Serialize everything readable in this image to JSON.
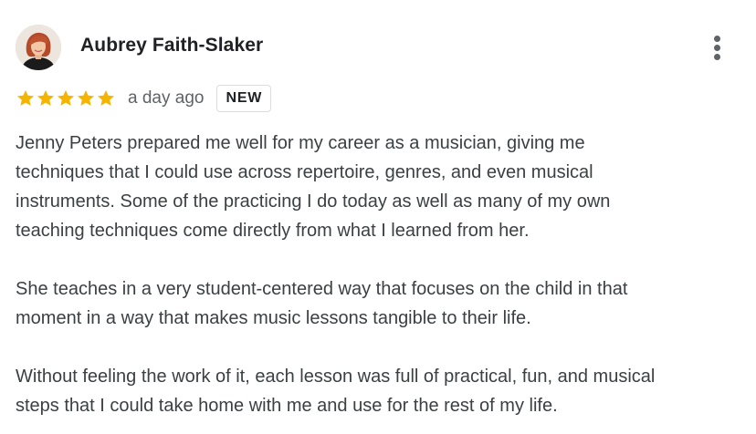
{
  "review": {
    "author_name": "Aubrey Faith-Slaker",
    "rating": 5,
    "rating_max": 5,
    "time_ago": "a day ago",
    "badge": "NEW",
    "star_color": "#f4b400",
    "paragraphs": [
      "Jenny Peters prepared me well for my career as a musician, giving me\ntechniques that I could use across repertoire, genres, and even musical\ninstruments. Some of the practicing I do today as well as many of my own\nteaching techniques come directly from what I learned from her.",
      "She teaches in a very student-centered way that focuses on the child in that\nmoment in a way that makes music lessons tangible to their life.",
      "Without feeling the work of it, each lesson was full of practical, fun, and musical\nsteps that I could take home with me and use for the rest of my life."
    ]
  },
  "icons": {
    "more": "more-vert-icon",
    "star": "star-icon",
    "avatar": "profile-photo"
  }
}
